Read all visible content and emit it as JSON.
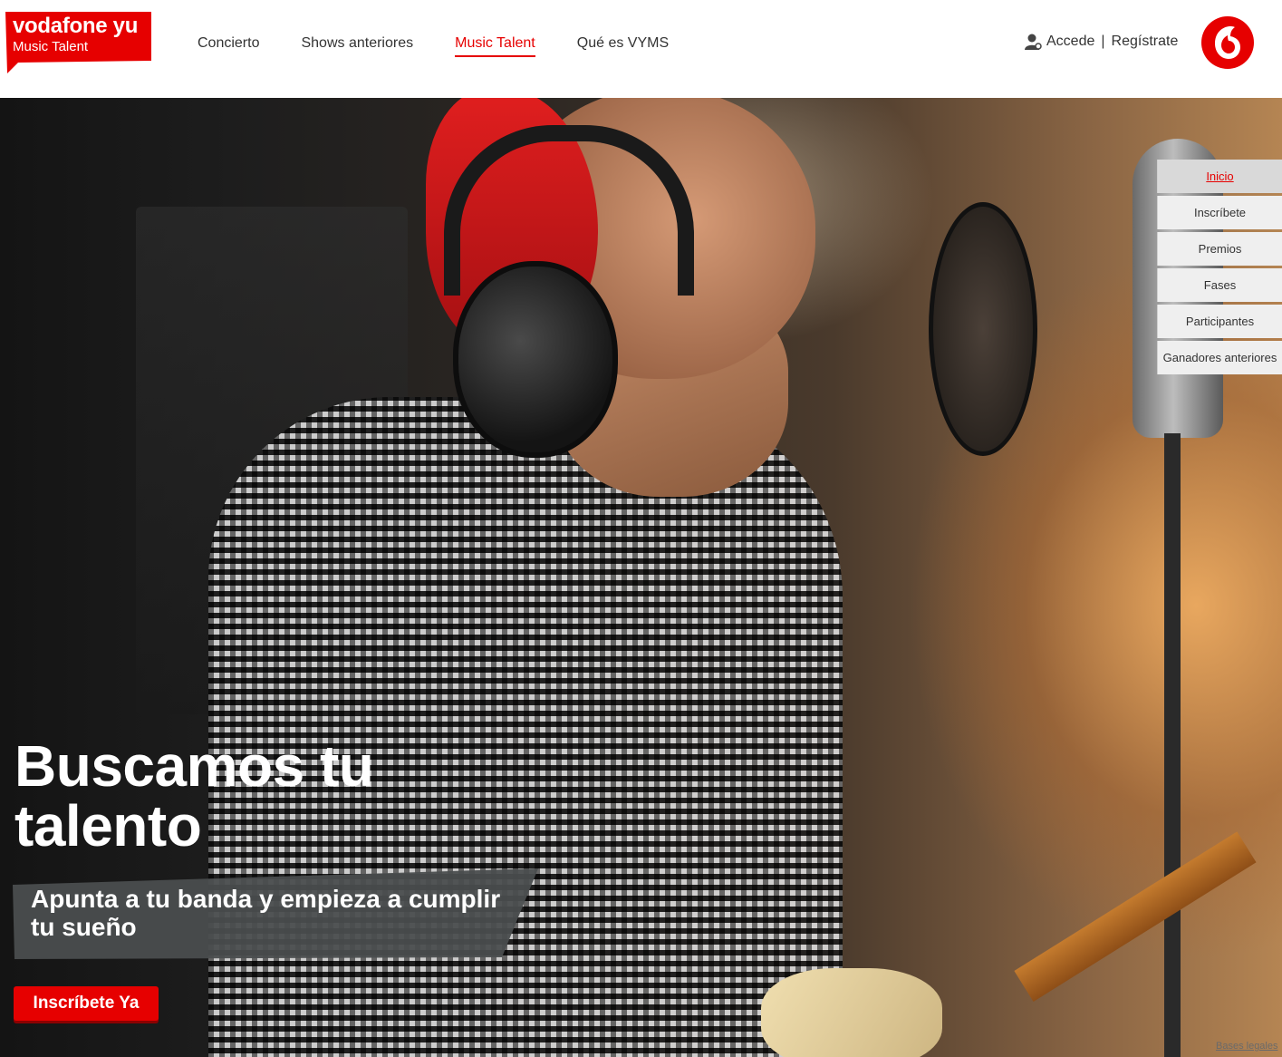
{
  "brand": {
    "name": "vodafone yu",
    "subtitle": "Music Talent",
    "accent_color": "#e60000"
  },
  "nav": {
    "items": [
      {
        "label": "Concierto",
        "active": false
      },
      {
        "label": "Shows anteriores",
        "active": false
      },
      {
        "label": "Music Talent",
        "active": true
      },
      {
        "label": "Qué es VYMS",
        "active": false
      }
    ]
  },
  "account": {
    "icon": "user-icon",
    "login_label": "Accede",
    "separator": "|",
    "register_label": "Regístrate"
  },
  "hero": {
    "title_line1": "Buscamos tu",
    "title_line2": "talento",
    "subtitle": "Apunta a tu banda y empieza a cumplir tu sueño",
    "cta_label": "Inscríbete Ya",
    "image_description": "singer with headphones and red beanie in recording studio"
  },
  "side_menu": {
    "items": [
      {
        "label": "Inicio",
        "active": true
      },
      {
        "label": "Inscríbete",
        "active": false
      },
      {
        "label": "Premios",
        "active": false
      },
      {
        "label": "Fases",
        "active": false
      },
      {
        "label": "Participantes",
        "active": false
      },
      {
        "label": "Ganadores anteriores",
        "active": false
      }
    ]
  },
  "footer": {
    "legal_label": "Bases legales"
  }
}
